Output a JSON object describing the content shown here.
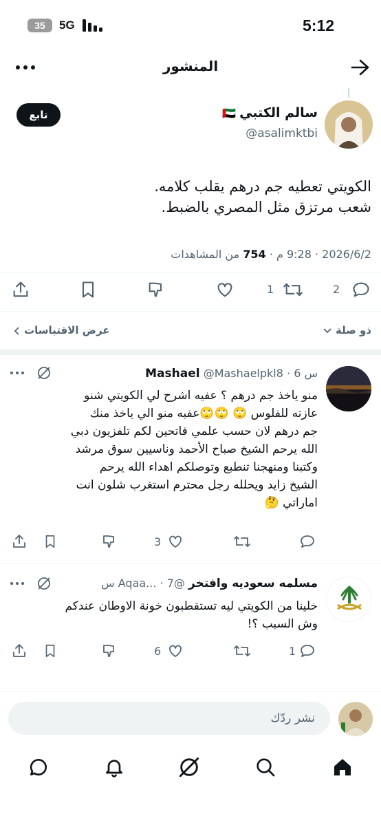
{
  "status": {
    "time": "5:12",
    "network": "5G",
    "battery": "35"
  },
  "header": {
    "title": "المنشور",
    "back_icon": "arrow-right-icon",
    "more_icon": "more-icon"
  },
  "post": {
    "author_name": "سالم الكتبي",
    "flag": "🇦🇪",
    "handle": "@asalimktbi",
    "follow_label": "تابع",
    "text_line1": "الكويتي تعطيه جم درهم يقلب كلامه.",
    "text_line2": "شعب مرتزق مثل المصري بالضبط.",
    "date": "2026/6/2",
    "time": "9:28 م",
    "views_count": "754",
    "views_label": "من المشاهدات",
    "actions": {
      "replies": "2",
      "reposts": "1",
      "likes": "",
      "bookmarks": ""
    }
  },
  "subbar": {
    "relevance": "ذو صلة",
    "quotes": "عرض الاقتباسات"
  },
  "replies": [
    {
      "name": "Mashael",
      "handle": "@Mashaelpkl8",
      "time": "6 س",
      "lines": [
        "منو ياخذ جم درهم ؟ عفيه اشرح لي الكويتي شنو",
        "عازته للفلوس 🙄 🙄🙄عفيه منو الي ياخذ منك",
        "جم درهم لان حسب علمي فاتحين لكم تلفزيون دبي",
        "الله يرحم الشيخ صباح الأحمد وناسيين سوق مرشد",
        "وكتبنا ومنهجنا تنطبع وتوصلكم اهداء الله يرحم",
        "الشيخ زايد ويحلله رجل محترم استغرب شلون انت",
        "اماراتي 🤔"
      ],
      "replies": "",
      "reposts": "",
      "likes": "3"
    },
    {
      "name": "مسلمه سعوديه وافتخر",
      "handle": "@Aqaa...",
      "time": "7 س",
      "lines": [
        "خلينا من الكويتي ليه تستقطبون خونة الاوطان عندكم",
        "وش السبب ؟!"
      ],
      "replies": "1",
      "reposts": "",
      "likes": "6"
    }
  ],
  "compose": {
    "placeholder": "نشر ردّك"
  },
  "bottom_nav": [
    "home-icon",
    "search-icon",
    "grok-icon",
    "notifications-icon",
    "messages-icon"
  ]
}
